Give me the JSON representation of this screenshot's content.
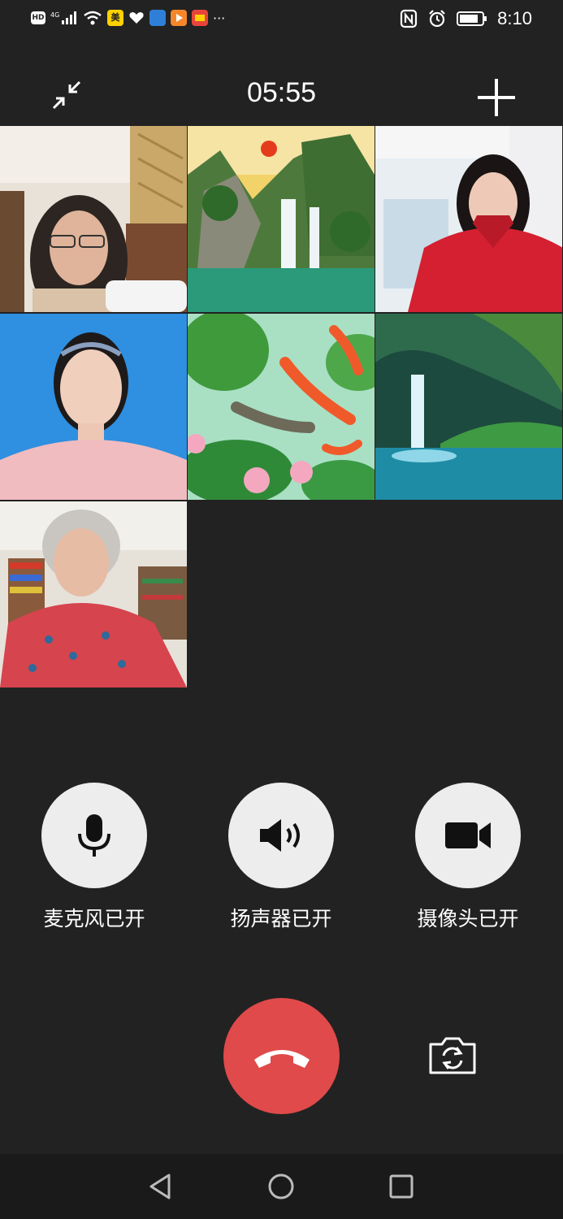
{
  "status_bar": {
    "time": "8:10",
    "left_icons": [
      "hd-icon",
      "signal-4g-icon",
      "wifi-icon",
      "app-meituan-icon",
      "heart-icon",
      "app-news-icon",
      "app-video-icon",
      "app-gallery-icon",
      "more-dots-icon"
    ],
    "meituan_label": "美",
    "more": "···",
    "right_icons": [
      "nfc-icon",
      "alarm-icon",
      "battery-icon"
    ]
  },
  "header": {
    "timer": "05:55"
  },
  "participants": [
    {
      "id": "p1",
      "kind": "camera-indoor-woman-glasses"
    },
    {
      "id": "p2",
      "kind": "landscape-waterfall-cranes"
    },
    {
      "id": "p3",
      "kind": "camera-woman-red-coat"
    },
    {
      "id": "p4",
      "kind": "portrait-woman-blue-bg"
    },
    {
      "id": "p5",
      "kind": "koi-lotus-painting"
    },
    {
      "id": "p6",
      "kind": "waterfall-lake"
    },
    {
      "id": "p7",
      "kind": "camera-older-woman-bookshelf"
    }
  ],
  "controls": {
    "mic_label": "麦克风已开",
    "speaker_label": "扬声器已开",
    "camera_label": "摄像头已开"
  },
  "colors": {
    "background": "#222222",
    "hangup": "#e04a4a",
    "control_circle": "#ededed"
  }
}
